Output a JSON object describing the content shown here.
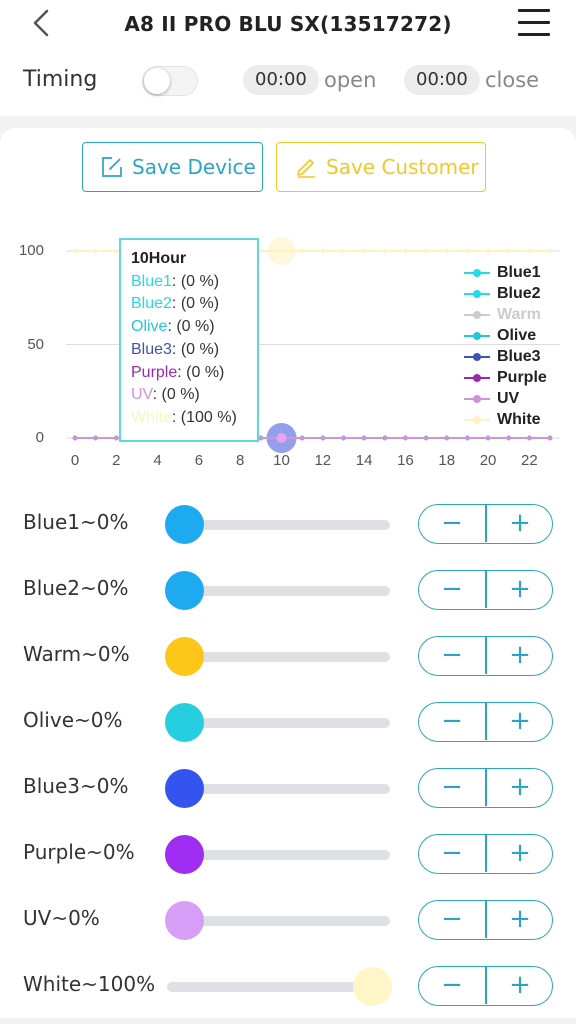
{
  "header": {
    "title": "A8 II PRO BLU SX(13517272)"
  },
  "timing": {
    "label": "Timing",
    "open_time": "00:00",
    "open_label": "open",
    "close_time": "00:00",
    "close_label": "close",
    "enabled": false
  },
  "buttons": {
    "save_device": "Save Device",
    "save_customer": "Save Customer"
  },
  "tooltip": {
    "title": "10Hour",
    "items": [
      {
        "name": "Blue1",
        "value": ": (0 %)",
        "color": "#26d9e6"
      },
      {
        "name": "Blue2",
        "value": ": (0 %)",
        "color": "#26d9e6"
      },
      {
        "name": "Olive",
        "value": ": (0 %)",
        "color": "#26c6da"
      },
      {
        "name": "Blue3",
        "value": ": (0 %)",
        "color": "#3f51b5"
      },
      {
        "name": "Purple",
        "value": ": (0 %)",
        "color": "#9c27b0"
      },
      {
        "name": "UV",
        "value": ": (0 %)",
        "color": "#ce93d8"
      },
      {
        "name": "White",
        "value": ": (100 %)",
        "color": "#fff3c4"
      }
    ]
  },
  "chart_data": {
    "type": "line",
    "xlabel": "",
    "ylabel": "",
    "xlim": [
      0,
      23
    ],
    "ylim": [
      0,
      100
    ],
    "x_ticks": [
      "0",
      "2",
      "4",
      "6",
      "8",
      "10",
      "12",
      "14",
      "16",
      "18",
      "20",
      "22"
    ],
    "y_ticks": [
      "0",
      "50",
      "100"
    ],
    "x": [
      0,
      1,
      2,
      3,
      4,
      5,
      6,
      7,
      8,
      9,
      10,
      11,
      12,
      13,
      14,
      15,
      16,
      17,
      18,
      19,
      20,
      21,
      22,
      23
    ],
    "legend_position": "right",
    "grid": true,
    "highlight_x": 10,
    "series": [
      {
        "name": "Blue1",
        "color": "#26d9e6",
        "values": [
          0,
          0,
          0,
          0,
          0,
          0,
          0,
          0,
          0,
          0,
          0,
          0,
          0,
          0,
          0,
          0,
          0,
          0,
          0,
          0,
          0,
          0,
          0,
          0
        ]
      },
      {
        "name": "Blue2",
        "color": "#26d9e6",
        "values": [
          0,
          0,
          0,
          0,
          0,
          0,
          0,
          0,
          0,
          0,
          0,
          0,
          0,
          0,
          0,
          0,
          0,
          0,
          0,
          0,
          0,
          0,
          0,
          0
        ]
      },
      {
        "name": "Warm",
        "color": "#cccccc",
        "hidden": true,
        "values": [
          0,
          0,
          0,
          0,
          0,
          0,
          0,
          0,
          0,
          0,
          0,
          0,
          0,
          0,
          0,
          0,
          0,
          0,
          0,
          0,
          0,
          0,
          0,
          0
        ]
      },
      {
        "name": "Olive",
        "color": "#26c6da",
        "values": [
          0,
          0,
          0,
          0,
          0,
          0,
          0,
          0,
          0,
          0,
          0,
          0,
          0,
          0,
          0,
          0,
          0,
          0,
          0,
          0,
          0,
          0,
          0,
          0
        ]
      },
      {
        "name": "Blue3",
        "color": "#3f51b5",
        "values": [
          0,
          0,
          0,
          0,
          0,
          0,
          0,
          0,
          0,
          0,
          0,
          0,
          0,
          0,
          0,
          0,
          0,
          0,
          0,
          0,
          0,
          0,
          0,
          0
        ]
      },
      {
        "name": "Purple",
        "color": "#9c27b0",
        "values": [
          0,
          0,
          0,
          0,
          0,
          0,
          0,
          0,
          0,
          0,
          0,
          0,
          0,
          0,
          0,
          0,
          0,
          0,
          0,
          0,
          0,
          0,
          0,
          0
        ]
      },
      {
        "name": "UV",
        "color": "#ce93d8",
        "values": [
          0,
          0,
          0,
          0,
          0,
          0,
          0,
          0,
          0,
          0,
          0,
          0,
          0,
          0,
          0,
          0,
          0,
          0,
          0,
          0,
          0,
          0,
          0,
          0
        ]
      },
      {
        "name": "White",
        "color": "#fff3c4",
        "values": [
          100,
          100,
          100,
          100,
          100,
          100,
          100,
          100,
          100,
          100,
          100,
          100,
          100,
          100,
          100,
          100,
          100,
          100,
          100,
          100,
          100,
          100,
          100,
          100
        ]
      }
    ]
  },
  "channels": [
    {
      "label": "Blue1~0%",
      "value": 0,
      "color": "#1eaaf1"
    },
    {
      "label": "Blue2~0%",
      "value": 0,
      "color": "#1eaaf1"
    },
    {
      "label": "Warm~0%",
      "value": 0,
      "color": "#ffc61a"
    },
    {
      "label": "Olive~0%",
      "value": 0,
      "color": "#26cfe0"
    },
    {
      "label": "Blue3~0%",
      "value": 0,
      "color": "#3454f0"
    },
    {
      "label": "Purple~0%",
      "value": 0,
      "color": "#a02cf2"
    },
    {
      "label": "UV~0%",
      "value": 0,
      "color": "#d69ef7"
    },
    {
      "label": "White~100%",
      "value": 100,
      "color": "#fff6c8"
    }
  ],
  "stepper": {
    "minus": "−",
    "plus": "+"
  }
}
